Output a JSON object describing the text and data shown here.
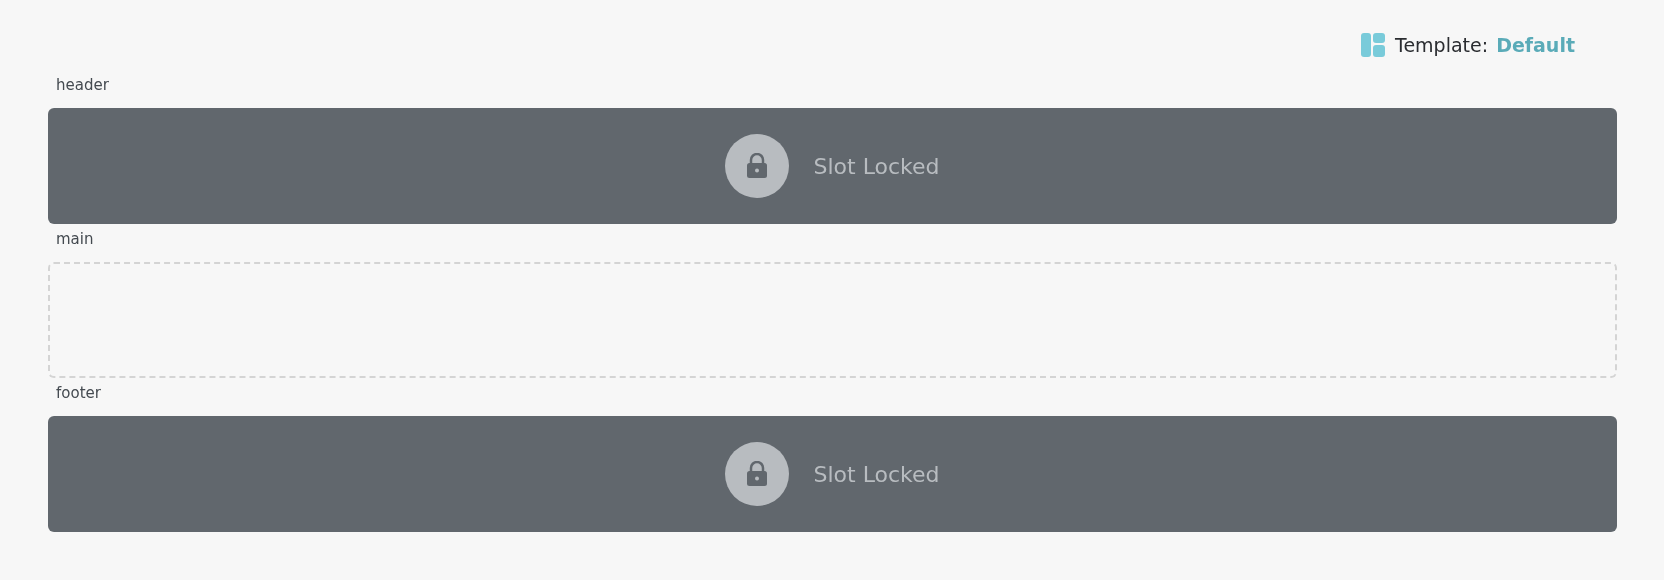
{
  "template": {
    "label": "Template:",
    "value": "Default"
  },
  "slots": [
    {
      "name": "header",
      "kind": "locked",
      "message": "Slot Locked"
    },
    {
      "name": "main",
      "kind": "empty"
    },
    {
      "name": "footer",
      "kind": "locked",
      "message": "Slot Locked"
    }
  ]
}
